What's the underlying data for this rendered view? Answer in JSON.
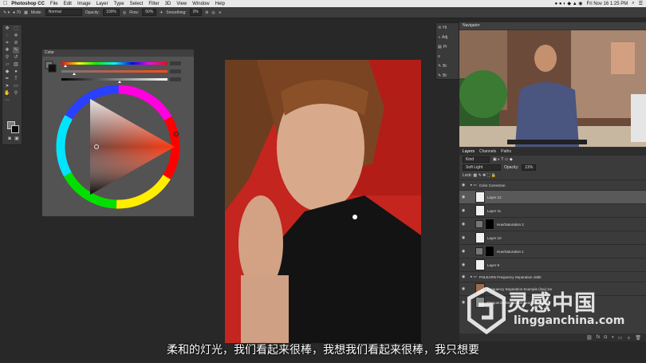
{
  "menubar": {
    "app": "Photoshop CC",
    "items": [
      "File",
      "Edit",
      "Image",
      "Layer",
      "Type",
      "Select",
      "Filter",
      "3D",
      "View",
      "Window",
      "Help"
    ],
    "clock": "Fri Nov 16  1:25 PM"
  },
  "options": {
    "mode_label": "Mode:",
    "mode_value": "Normal",
    "opacity_label": "Opacity:",
    "opacity_value": "100%",
    "flow_label": "Flow:",
    "flow_value": "50%",
    "smoothing_label": "Smoothing:",
    "smoothing_value": "0%"
  },
  "color_panel": {
    "title": "Color"
  },
  "minidock": [
    "Hi",
    "Adj",
    "Pr",
    "",
    "Br",
    "Br"
  ],
  "navigator": {
    "title": "Navigator"
  },
  "layers_panel": {
    "tabs": [
      "Layers",
      "Channels",
      "Paths"
    ],
    "kind": "Kind",
    "blend": "Soft Light",
    "opacity_label": "Opacity:",
    "opacity_value": "11%",
    "rows": [
      {
        "name": "Color Correction"
      },
      {
        "name": "Layer 12"
      },
      {
        "name": "Layer 11"
      },
      {
        "name": "Hue/Saturation 2"
      },
      {
        "name": "Layer 10"
      },
      {
        "name": "Hue/Saturation 1"
      },
      {
        "name": "Layer 9"
      },
      {
        "name": "PHLEARN Frequency Separation 16bit"
      },
      {
        "name": "Frequency Separation Example (low) sm"
      },
      {
        "name": "Frequency Separation Example (high)"
      }
    ]
  },
  "subtitle": "柔和的灯光，我们看起来很棒，我想我们看起来很棒，我只想要",
  "watermark": {
    "big": "灵感中国",
    "small": "lingganchina.com"
  },
  "colors": {
    "red_bg": "#c4251f",
    "accent": "#3a6ab3"
  }
}
